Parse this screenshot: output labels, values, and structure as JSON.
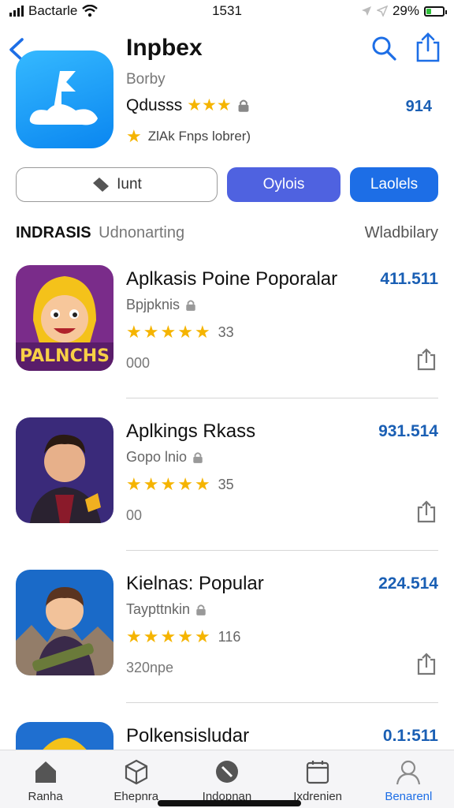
{
  "status_bar": {
    "carrier": "Bactarle",
    "time": "1531",
    "battery": "29%",
    "battery_level": 0.29
  },
  "app": {
    "title": "Inpbex",
    "developer": "Borby",
    "rating_label": "Qdusss",
    "rating_stars": 3,
    "count": "914",
    "subtitle": "ZlAk Fnps lobrer)"
  },
  "actions": {
    "hunt_label": "Iunt",
    "oglois_label": "Oylois",
    "labels_label": "Laolels"
  },
  "section": {
    "title": "INDRASIS",
    "subtitle": "Udnonarting",
    "right": "Wladbilary"
  },
  "items": [
    {
      "title": "Aplkasis Poine Poporalar",
      "developer": "Bpjpknis",
      "rating": 4.5,
      "rating_count": "33",
      "meta": "000",
      "price": "411.511",
      "thumb_label": "PALNCHS",
      "thumb_bg": "#7a2c8a"
    },
    {
      "title": "Aplkings Rkass",
      "developer": "Gopo lnio",
      "rating": 4.5,
      "rating_count": "35",
      "meta": "00",
      "price": "931.514",
      "thumb_label": "",
      "thumb_bg": "#3a2a7a"
    },
    {
      "title": "Kielnas: Popular",
      "developer": "Taypttnkin",
      "rating": 4.5,
      "rating_count": "116",
      "meta": "320npe",
      "price": "224.514",
      "thumb_label": "",
      "thumb_bg": "#1a6ac8"
    },
    {
      "title": "Polkensisludar",
      "developer": "",
      "rating": 0,
      "rating_count": "",
      "meta": "",
      "price": "0.1:511",
      "thumb_label": "",
      "thumb_bg": "#1f6fd0"
    }
  ],
  "tabs": [
    {
      "label": "Ranha",
      "icon": "home-icon",
      "active": false
    },
    {
      "label": "Ehepnra",
      "icon": "cube-icon",
      "active": false
    },
    {
      "label": "Indopnan",
      "icon": "compass-icon",
      "active": false
    },
    {
      "label": "Ixdrenien",
      "icon": "calendar-icon",
      "active": false
    },
    {
      "label": "Benarenl",
      "icon": "person-icon",
      "active": true
    }
  ],
  "colors": {
    "accent": "#1d6ee6",
    "purple_button": "#4f62e0",
    "star": "#f5b400",
    "price": "#1a5fb4"
  }
}
